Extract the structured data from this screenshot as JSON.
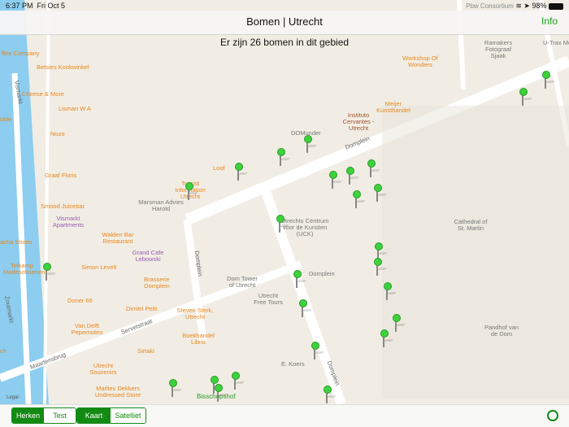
{
  "status": {
    "time": "6:37 PM",
    "date": "Fri Oct 5",
    "carrier": "Pbw Consortium",
    "battery": "98%"
  },
  "nav": {
    "title": "Bomen | Utrecht",
    "info": "Info"
  },
  "count_text": "Er zijn 26 bomen in dit gebied",
  "map": {
    "labels_poi": [
      "ffee Company",
      "Betsies Kookwinkel",
      "Cheese & More",
      "Lisman W A",
      "Nozo",
      "Graaf Floris",
      "Smood Juicebar",
      "Walden Bar Restaurant",
      "Simon Levelt",
      "Doner 66",
      "Dimitri Petit",
      "Van Delft Pepernoten",
      "Sirtaki",
      "Utrecht Souvenirs",
      "Marlies Dekkers Undressed Store",
      "Loof",
      "Tourist Information Utrecht",
      "Meijer Kunsthandel",
      "Workshop Of Wonders",
      "Steven Sterk, Utrecht",
      "Boekhandel Libris",
      "Brasserie Domplein",
      "Telkamp Modeschoenen",
      "acha Shoes",
      "oble",
      "ch"
    ],
    "labels_gray": [
      "DOMunder",
      "Marsman Advies Harold",
      "Utrechts Centrum voor de Kunsten (UCK)",
      "Domplein",
      "Dom Tower of Utrecht",
      "Utrecht Free Tours",
      "Cathedral of St. Martin",
      "Pandhof van de Dom",
      "E. Koers",
      "Ramakers Fotograaf Sjaak",
      "U-Trax Me",
      "Instituto Cervantes - Utrecht"
    ],
    "labels_purple": [
      "Vismarkt Apartments",
      "Grand Cafe Lebowski"
    ],
    "streets": [
      "Vismarkt",
      "Zoutmarkt",
      "Servetstraat",
      "Maartensbrug",
      "Domplein",
      "Domplein",
      "Domplein",
      "Domplein"
    ],
    "green_label": "Bisschopshof",
    "legal": "Legal",
    "pin_count": 26
  },
  "toolbar": {
    "mode": [
      "Herken",
      "Test"
    ],
    "mode_selected": "Herken",
    "maptype": [
      "Kaart",
      "Satelliet"
    ],
    "maptype_selected": "Kaart"
  },
  "colors": {
    "accent": "#138a13",
    "pin": "#3dd23d",
    "water": "#8ccdf0",
    "poi": "#e8871e"
  }
}
